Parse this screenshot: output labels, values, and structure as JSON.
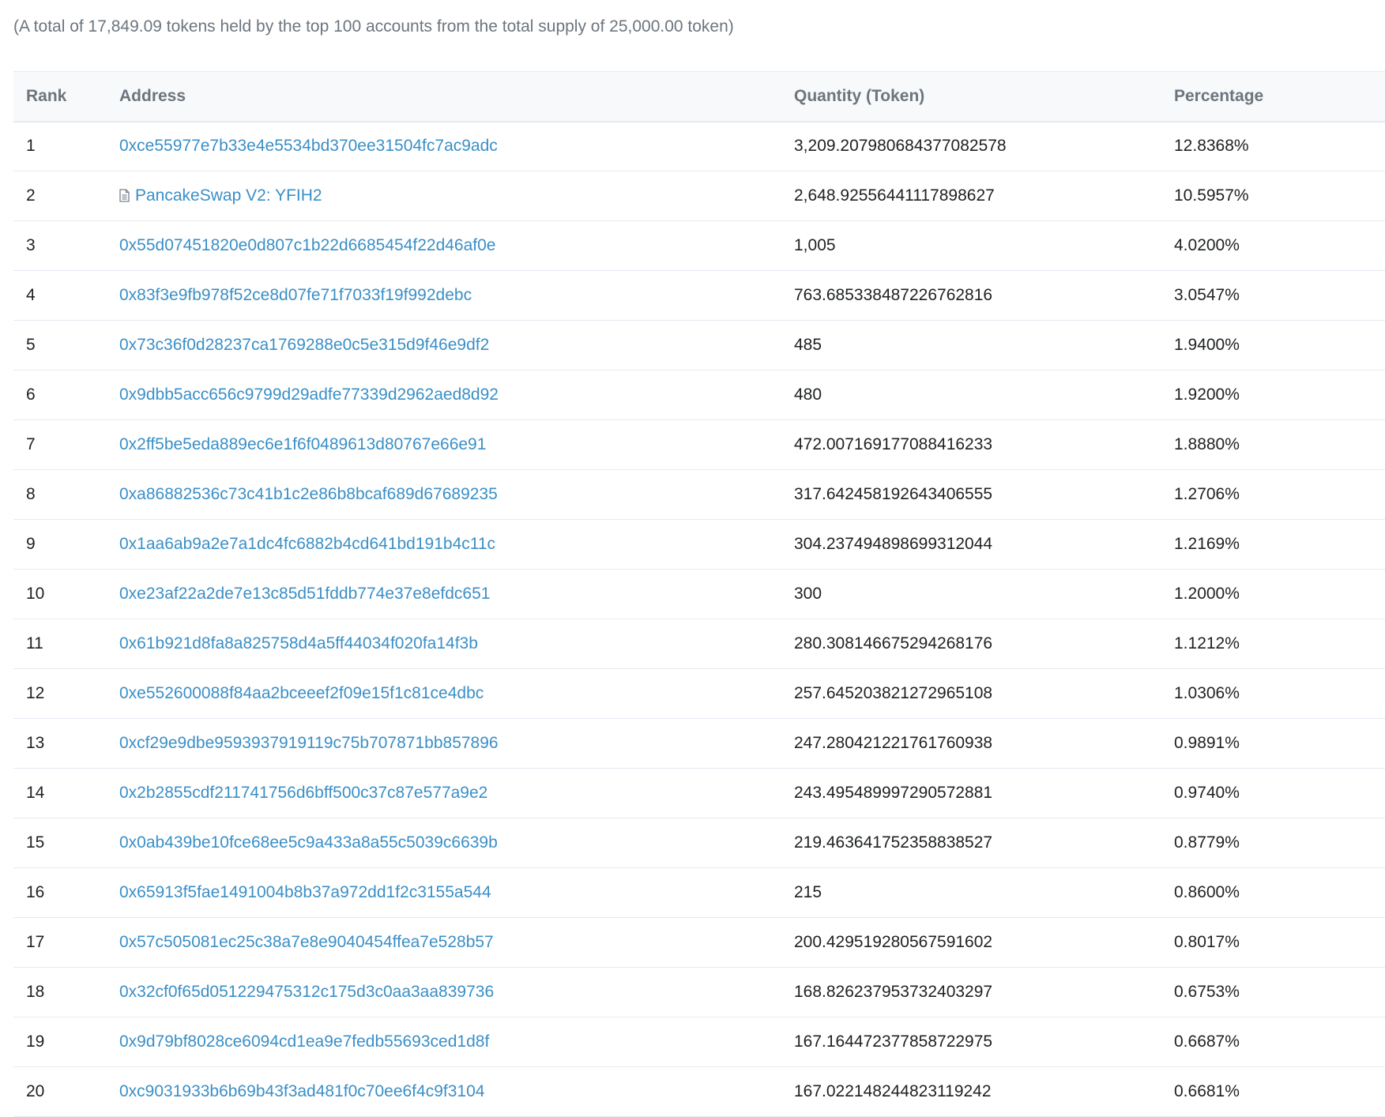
{
  "summary": "(A total of 17,849.09 tokens held by the top 100 accounts from the total supply of 25,000.00 token)",
  "table": {
    "headers": {
      "rank": "Rank",
      "address": "Address",
      "quantity": "Quantity (Token)",
      "percentage": "Percentage"
    },
    "rows": [
      {
        "rank": "1",
        "address": "0xce55977e7b33e4e5534bd370ee31504fc7ac9adc",
        "quantity": "3,209.207980684377082578",
        "percentage": "12.8368%"
      },
      {
        "rank": "2",
        "address": "PancakeSwap V2: YFIH2",
        "contract": true,
        "quantity": "2,648.92556441117898627",
        "percentage": "10.5957%"
      },
      {
        "rank": "3",
        "address": "0x55d07451820e0d807c1b22d6685454f22d46af0e",
        "quantity": "1,005",
        "percentage": "4.0200%"
      },
      {
        "rank": "4",
        "address": "0x83f3e9fb978f52ce8d07fe71f7033f19f992debc",
        "quantity": "763.685338487226762816",
        "percentage": "3.0547%"
      },
      {
        "rank": "5",
        "address": "0x73c36f0d28237ca1769288e0c5e315d9f46e9df2",
        "quantity": "485",
        "percentage": "1.9400%"
      },
      {
        "rank": "6",
        "address": "0x9dbb5acc656c9799d29adfe77339d2962aed8d92",
        "quantity": "480",
        "percentage": "1.9200%"
      },
      {
        "rank": "7",
        "address": "0x2ff5be5eda889ec6e1f6f0489613d80767e66e91",
        "quantity": "472.007169177088416233",
        "percentage": "1.8880%"
      },
      {
        "rank": "8",
        "address": "0xa86882536c73c41b1c2e86b8bcaf689d67689235",
        "quantity": "317.642458192643406555",
        "percentage": "1.2706%"
      },
      {
        "rank": "9",
        "address": "0x1aa6ab9a2e7a1dc4fc6882b4cd641bd191b4c11c",
        "quantity": "304.237494898699312044",
        "percentage": "1.2169%"
      },
      {
        "rank": "10",
        "address": "0xe23af22a2de7e13c85d51fddb774e37e8efdc651",
        "quantity": "300",
        "percentage": "1.2000%"
      },
      {
        "rank": "11",
        "address": "0x61b921d8fa8a825758d4a5ff44034f020fa14f3b",
        "quantity": "280.308146675294268176",
        "percentage": "1.1212%"
      },
      {
        "rank": "12",
        "address": "0xe552600088f84aa2bceeef2f09e15f1c81ce4dbc",
        "quantity": "257.645203821272965108",
        "percentage": "1.0306%"
      },
      {
        "rank": "13",
        "address": "0xcf29e9dbe9593937919119c75b707871bb857896",
        "quantity": "247.280421221761760938",
        "percentage": "0.9891%"
      },
      {
        "rank": "14",
        "address": "0x2b2855cdf211741756d6bff500c37c87e577a9e2",
        "quantity": "243.495489997290572881",
        "percentage": "0.9740%"
      },
      {
        "rank": "15",
        "address": "0x0ab439be10fce68ee5c9a433a8a55c5039c6639b",
        "quantity": "219.463641752358838527",
        "percentage": "0.8779%"
      },
      {
        "rank": "16",
        "address": "0x65913f5fae1491004b8b37a972dd1f2c3155a544",
        "quantity": "215",
        "percentage": "0.8600%"
      },
      {
        "rank": "17",
        "address": "0x57c505081ec25c38a7e8e9040454ffea7e528b57",
        "quantity": "200.429519280567591602",
        "percentage": "0.8017%"
      },
      {
        "rank": "18",
        "address": "0x32cf0f65d051229475312c175d3c0aa3aa839736",
        "quantity": "168.826237953732403297",
        "percentage": "0.6753%"
      },
      {
        "rank": "19",
        "address": "0x9d79bf8028ce6094cd1ea9e7fedb55693ced1d8f",
        "quantity": "167.164472377858722975",
        "percentage": "0.6687%"
      },
      {
        "rank": "20",
        "address": "0xc9031933b6b69b43f3ad481f0c70ee6f4c9f3104",
        "quantity": "167.022148244823119242",
        "percentage": "0.6681%"
      }
    ]
  },
  "colors": {
    "link": "#3a8fc7",
    "muted_text": "#6c757e",
    "row_border": "#e7eaf3"
  },
  "icons": {
    "contract": "document-icon"
  }
}
